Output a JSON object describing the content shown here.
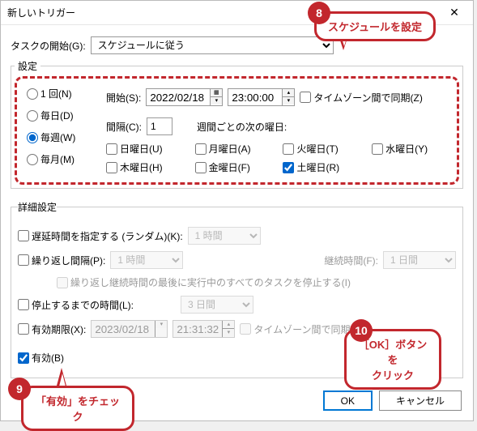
{
  "window": {
    "title": "新しいトリガー",
    "close": "✕"
  },
  "taskStart": {
    "label": "タスクの開始(G):",
    "value": "スケジュールに従う"
  },
  "settings": {
    "legend": "設定",
    "freq": {
      "once": "1 回(N)",
      "daily": "毎日(D)",
      "weekly": "毎週(W)",
      "monthly": "毎月(M)"
    },
    "start_label": "開始(S):",
    "start_date": "2022/02/18",
    "start_time": "23:00:00",
    "tz_sync": "タイムゾーン間で同期(Z)",
    "interval_label": "間隔(C):",
    "interval_value": "1",
    "weekdays_label": "週間ごとの次の曜日:",
    "days": {
      "sun": "日曜日(U)",
      "mon": "月曜日(A)",
      "tue": "火曜日(T)",
      "wed": "水曜日(Y)",
      "thu": "木曜日(H)",
      "fri": "金曜日(F)",
      "sat": "土曜日(R)"
    }
  },
  "adv": {
    "legend": "詳細設定",
    "delay_label": "遅延時間を指定する (ランダム)(K):",
    "delay_val": "1 時間",
    "repeat_label": "繰り返し間隔(P):",
    "repeat_val": "1 時間",
    "duration_label": "継続時間(F):",
    "duration_val": "1 日間",
    "stop_repeat": "繰り返し継続時間の最後に実行中のすべてのタスクを停止する(I)",
    "stop_after_label": "停止するまでの時間(L):",
    "stop_after_val": "3 日間",
    "expire_label": "有効期限(X):",
    "expire_date": "2023/02/18",
    "expire_time": "21:31:32",
    "expire_tz": "タイムゾーン間で同期",
    "enabled_label": "有効(B)"
  },
  "footer": {
    "ok": "OK",
    "cancel": "キャンセル"
  },
  "callouts": {
    "c8": "スケジュールを設定",
    "c9": "「有効」をチェック",
    "c10_a": "［OK］ボタンを",
    "c10_b": "クリック"
  },
  "badges": {
    "b8": "8",
    "b9": "9",
    "b10": "10"
  }
}
